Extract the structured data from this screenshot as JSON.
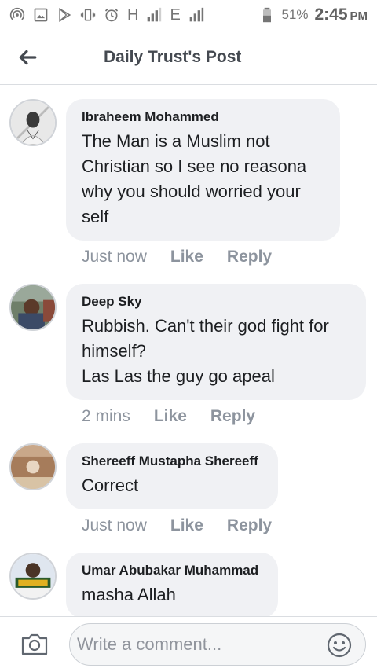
{
  "status_bar": {
    "icons": [
      "hotspot-icon",
      "image-icon",
      "play-store-icon",
      "vibrate-icon",
      "alarm-icon",
      "signal-icon",
      "battery-icon"
    ],
    "network_h": "H",
    "network_e": "E",
    "battery_percent": "51%",
    "time": "2:45",
    "ampm": "PM"
  },
  "header": {
    "title": "Daily Trust's Post"
  },
  "comments": [
    {
      "author": "Ibraheem Mohammed",
      "text": "The Man is a Muslim not Christian so I see no reasona why you should worried your self",
      "time": "Just now",
      "like_label": "Like",
      "reply_label": "Reply"
    },
    {
      "author": "Deep Sky",
      "text": "Rubbish. Can't their god fight for himself?\nLas Las the guy go apeal",
      "time": "2 mins",
      "like_label": "Like",
      "reply_label": "Reply"
    },
    {
      "author": "Shereeff Mustapha Shereeff",
      "text": "Correct",
      "time": "Just now",
      "like_label": "Like",
      "reply_label": "Reply"
    },
    {
      "author": "Umar Abubakar Muhammad",
      "text": "masha Allah",
      "time": "",
      "like_label": "",
      "reply_label": ""
    }
  ],
  "composer": {
    "placeholder": "Write a comment..."
  },
  "colors": {
    "bubble": "#f0f1f4",
    "action_text": "#8d949e",
    "header_text": "#444950"
  }
}
